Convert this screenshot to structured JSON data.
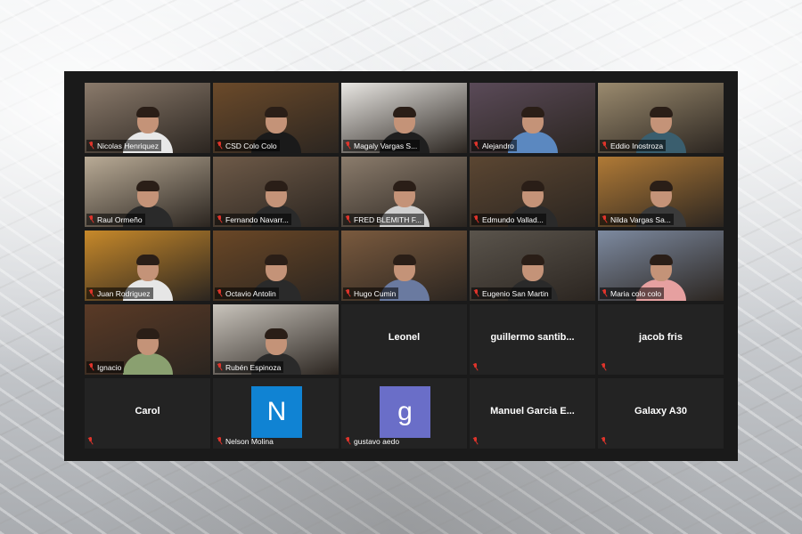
{
  "meeting": {
    "participants": [
      {
        "name": "Nicolas Henriquez",
        "video": true,
        "bg": "#8a7a6b",
        "shirt": "#e8e8e8"
      },
      {
        "name": "CSD Colo Colo",
        "video": true,
        "active": true,
        "bg": "#6b4a2a",
        "shirt": "#1a1a1a"
      },
      {
        "name": "Magaly Vargas S...",
        "video": true,
        "bg": "#e8e6e2",
        "shirt": "#1f1f1f"
      },
      {
        "name": "Alejandro",
        "video": true,
        "bg": "#5a4a58",
        "shirt": "#5b88c0"
      },
      {
        "name": "Eddio Inostroza",
        "video": true,
        "bg": "#9a8a6e",
        "shirt": "#3a5e6e"
      },
      {
        "name": "Raul Ormeño",
        "video": true,
        "bg": "#b9ab96",
        "shirt": "#2a2a2a"
      },
      {
        "name": "Fernando Navarr...",
        "video": true,
        "bg": "#6e5a48",
        "shirt": "#2a2a2a"
      },
      {
        "name": "FRED BLEMITH F...",
        "video": true,
        "bg": "#8b7c6c",
        "shirt": "#cfcfcf"
      },
      {
        "name": "Edmundo Vallad...",
        "video": true,
        "bg": "#5b4632",
        "shirt": "#2a2a2a"
      },
      {
        "name": "Nilda Vargas Sa...",
        "video": true,
        "bg": "#b07a36",
        "shirt": "#3a3a3a"
      },
      {
        "name": "Juan Rodriguez",
        "video": true,
        "bg": "#c7892a",
        "shirt": "#e6e6e6"
      },
      {
        "name": "Octavio Antolin",
        "video": true,
        "bg": "#6a4726",
        "shirt": "#2a2a2a"
      },
      {
        "name": "Hugo Cumin",
        "video": true,
        "bg": "#7a5a3e",
        "shirt": "#6a7aa0"
      },
      {
        "name": "Eugenio San Martin",
        "video": true,
        "bg": "#5a544c",
        "shirt": "#2a2a2a"
      },
      {
        "name": "Maria colo colo",
        "video": true,
        "bg": "#7d8aa0",
        "shirt": "#e6a0a0"
      },
      {
        "name": "Ignacio",
        "video": true,
        "bg": "#5a3a26",
        "shirt": "#8aa070"
      },
      {
        "name": "Rubén Espinoza",
        "video": true,
        "bg": "#c9c4bc",
        "shirt": "#2a2a2a"
      },
      {
        "name": "Leonel",
        "video": false,
        "mic": false
      },
      {
        "name": "guillermo  santib...",
        "video": false,
        "mic": true
      },
      {
        "name": "jacob fris",
        "video": false,
        "mic": true
      },
      {
        "name": "Carol",
        "video": false,
        "mic": true
      },
      {
        "name": "Nelson Molina",
        "video": false,
        "avatar": "N",
        "avatar_color": "#1083d3",
        "mic": true
      },
      {
        "name": "gustavo aedo",
        "video": false,
        "avatar": "g",
        "avatar_color": "#6a6ec8",
        "mic": true
      },
      {
        "name": "Manuel  Garcia  E...",
        "video": false,
        "mic": true
      },
      {
        "name": "Galaxy A30",
        "video": false,
        "mic": true
      }
    ]
  },
  "icons": {
    "muted": "mic-muted-icon"
  },
  "colors": {
    "active_border": "#c8e02d",
    "muted_red": "#e0342b",
    "tile_bg": "#232323",
    "frame_bg": "#1a1a1a"
  }
}
